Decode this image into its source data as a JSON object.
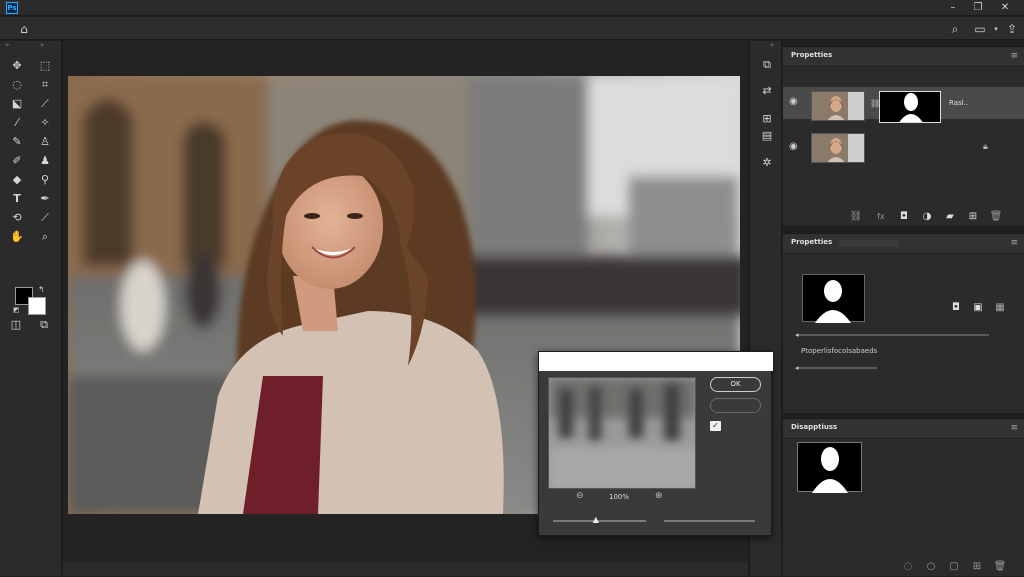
{
  "app": {
    "logo_text": "Ps",
    "window_controls": [
      "minimize-icon",
      "restore-icon",
      "close-icon"
    ]
  },
  "options_bar": {
    "icons": [
      "home-icon",
      "search-icon",
      "workspace-icon",
      "share-icon"
    ]
  },
  "tools": {
    "icons": [
      "move-icon",
      "marquee-icon",
      "lasso-icon",
      "crop-icon",
      "object-select-icon",
      "frame-icon",
      "eyedropper-icon",
      "healing-icon",
      "brush-icon",
      "stamp-icon",
      "history-brush-icon",
      "eraser-icon",
      "gradient-icon",
      "blur-icon",
      "dodge-icon",
      "pen-icon",
      "type-icon",
      "path-select-icon",
      "shape-icon",
      "rotate-view-icon",
      "hand-icon",
      "zoom-icon",
      "quick-mask-icon",
      "screen-mode-icon"
    ]
  },
  "layers_panel": {
    "tab_label": "Propetties",
    "layers": [
      {
        "name": "Rasl..",
        "has_mask": true,
        "locked": false
      },
      {
        "name": "",
        "has_mask": false,
        "locked": true
      }
    ],
    "footer_icons": [
      "link-icon",
      "fx-icon",
      "mask-icon",
      "adjustment-icon",
      "folder-icon",
      "new-layer-icon",
      "trash-icon"
    ]
  },
  "properties_panel": {
    "tab_label": "Propetties",
    "field_label": "Ptoperlisfocolsabaeds"
  },
  "dissolve_panel": {
    "tab_label": "Disapptiuss",
    "footer_icons": [
      "dotted-circle-icon",
      "circle-icon",
      "square-icon",
      "plus-square-icon",
      "trash-icon"
    ]
  },
  "dialog": {
    "ok_label": "OK",
    "zoom_level": "100%",
    "checkbox_checked": true,
    "slider_value": 0.47
  },
  "colors": {
    "accent": "#31a8ff",
    "panel_bg": "#2b2b2b",
    "canvas_bg": "#232323",
    "foreground_swatch": "#000000",
    "background_swatch": "#ffffff"
  }
}
